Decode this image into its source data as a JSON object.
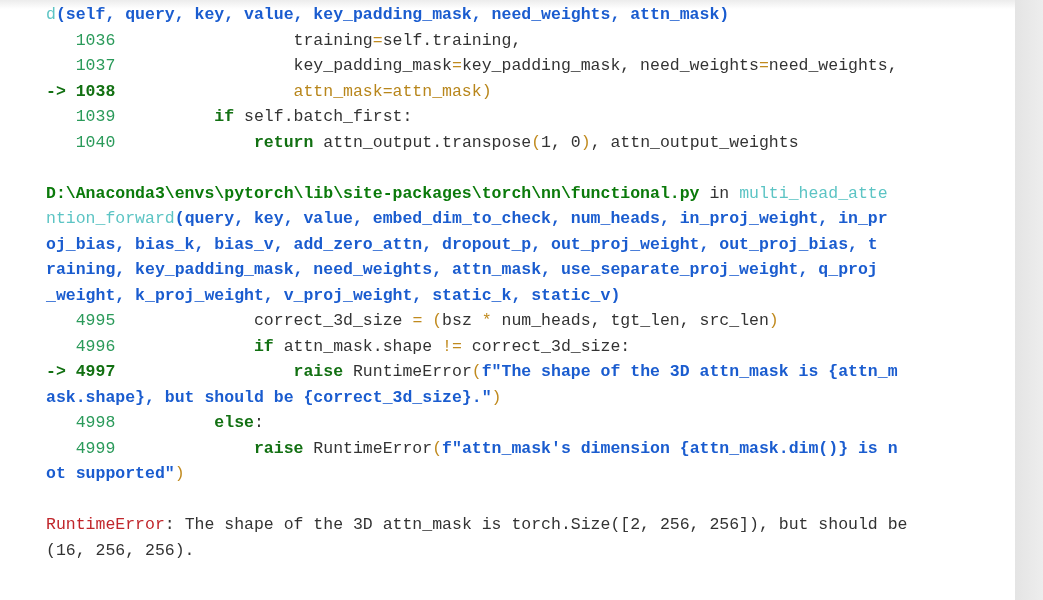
{
  "frames": [
    {
      "lines": [
        {
          "kind": "header",
          "segments": [
            {
              "kind": "func",
              "text": "d"
            },
            {
              "kind": "args",
              "text": "(self, query, key, value, key_padding_mask, need_weights, attn_mask)"
            }
          ]
        },
        {
          "kind": "code",
          "lineno": "1036",
          "current": false,
          "segments": [
            {
              "kind": "plain",
              "text": "                  training"
            },
            {
              "kind": "op",
              "text": "="
            },
            {
              "kind": "plain",
              "text": "self.training,"
            }
          ]
        },
        {
          "kind": "code",
          "lineno": "1037",
          "current": false,
          "segments": [
            {
              "kind": "plain",
              "text": "                  key_padding_mask"
            },
            {
              "kind": "op",
              "text": "="
            },
            {
              "kind": "plain",
              "text": "key_padding_mask, need_weights"
            },
            {
              "kind": "op",
              "text": "="
            },
            {
              "kind": "plain",
              "text": "need_weights,"
            }
          ]
        },
        {
          "kind": "code",
          "lineno": "1038",
          "current": true,
          "marker": "->",
          "segments": [
            {
              "kind": "hl",
              "text": "                  attn_mask=attn_mask)"
            }
          ]
        },
        {
          "kind": "code",
          "lineno": "1039",
          "current": false,
          "segments": [
            {
              "kind": "kw",
              "text": "          if"
            },
            {
              "kind": "plain",
              "text": " self.batch_first:"
            }
          ]
        },
        {
          "kind": "code",
          "lineno": "1040",
          "current": false,
          "segments": [
            {
              "kind": "kw",
              "text": "              return"
            },
            {
              "kind": "plain",
              "text": " attn_output.transpose"
            },
            {
              "kind": "op",
              "text": "("
            },
            {
              "kind": "plain",
              "text": "1, 0"
            },
            {
              "kind": "op",
              "text": ")"
            },
            {
              "kind": "plain",
              "text": ", attn_output_weights"
            }
          ]
        }
      ]
    },
    {
      "lines": [
        {
          "kind": "header",
          "segments": [
            {
              "kind": "path",
              "text": "D:\\Anaconda3\\envs\\pytorch\\lib\\site-packages\\torch\\nn\\functional.py"
            },
            {
              "kind": "plain",
              "text": " in "
            },
            {
              "kind": "func",
              "text": "multi_head_atte"
            }
          ]
        },
        {
          "kind": "header",
          "segments": [
            {
              "kind": "func",
              "text": "ntion_forward"
            },
            {
              "kind": "args",
              "text": "(query, key, value, embed_dim_to_check, num_heads, in_proj_weight, in_pr"
            }
          ]
        },
        {
          "kind": "header",
          "segments": [
            {
              "kind": "args",
              "text": "oj_bias, bias_k, bias_v, add_zero_attn, dropout_p, out_proj_weight, out_proj_bias, t"
            }
          ]
        },
        {
          "kind": "header",
          "segments": [
            {
              "kind": "args",
              "text": "raining, key_padding_mask, need_weights, attn_mask, use_separate_proj_weight, q_proj"
            }
          ]
        },
        {
          "kind": "header",
          "segments": [
            {
              "kind": "args",
              "text": "_weight, k_proj_weight, v_proj_weight, static_k, static_v)"
            }
          ]
        },
        {
          "kind": "code",
          "lineno": "4995",
          "current": false,
          "segments": [
            {
              "kind": "plain",
              "text": "              correct_3d_size "
            },
            {
              "kind": "op",
              "text": "= ("
            },
            {
              "kind": "plain",
              "text": "bsz "
            },
            {
              "kind": "op",
              "text": "*"
            },
            {
              "kind": "plain",
              "text": " num_heads, tgt_len, src_len"
            },
            {
              "kind": "op",
              "text": ")"
            }
          ]
        },
        {
          "kind": "code",
          "lineno": "4996",
          "current": false,
          "segments": [
            {
              "kind": "kw",
              "text": "              if"
            },
            {
              "kind": "plain",
              "text": " attn_mask.shape "
            },
            {
              "kind": "op",
              "text": "!="
            },
            {
              "kind": "plain",
              "text": " correct_3d_size:"
            }
          ]
        },
        {
          "kind": "code",
          "lineno": "4997",
          "current": true,
          "marker": "->",
          "segments": [
            {
              "kind": "kw",
              "text": "                  raise"
            },
            {
              "kind": "plain",
              "text": " RuntimeError"
            },
            {
              "kind": "op",
              "text": "("
            },
            {
              "kind": "args",
              "text": "f\"The shape of the 3D attn_mask is {attn_m"
            }
          ]
        },
        {
          "kind": "wrap",
          "segments": [
            {
              "kind": "args",
              "text": "ask.shape}, but should be {correct_3d_size}.\""
            },
            {
              "kind": "op",
              "text": ")"
            }
          ]
        },
        {
          "kind": "code",
          "lineno": "4998",
          "current": false,
          "segments": [
            {
              "kind": "kw",
              "text": "          else"
            },
            {
              "kind": "plain",
              "text": ":"
            }
          ]
        },
        {
          "kind": "code",
          "lineno": "4999",
          "current": false,
          "segments": [
            {
              "kind": "kw",
              "text": "              raise"
            },
            {
              "kind": "plain",
              "text": " RuntimeError"
            },
            {
              "kind": "op",
              "text": "("
            },
            {
              "kind": "args",
              "text": "f\"attn_mask's dimension {attn_mask.dim()} is n"
            }
          ]
        },
        {
          "kind": "wrap",
          "segments": [
            {
              "kind": "args",
              "text": "ot supported\""
            },
            {
              "kind": "op",
              "text": ")"
            }
          ]
        }
      ]
    }
  ],
  "error": {
    "lines": [
      [
        {
          "kind": "err",
          "text": "RuntimeError"
        },
        {
          "kind": "plain",
          "text": ": The shape of the 3D attn_mask is torch.Size([2, 256, 256]), but should be"
        }
      ],
      [
        {
          "kind": "plain",
          "text": "(16, 256, 256)."
        }
      ]
    ]
  }
}
